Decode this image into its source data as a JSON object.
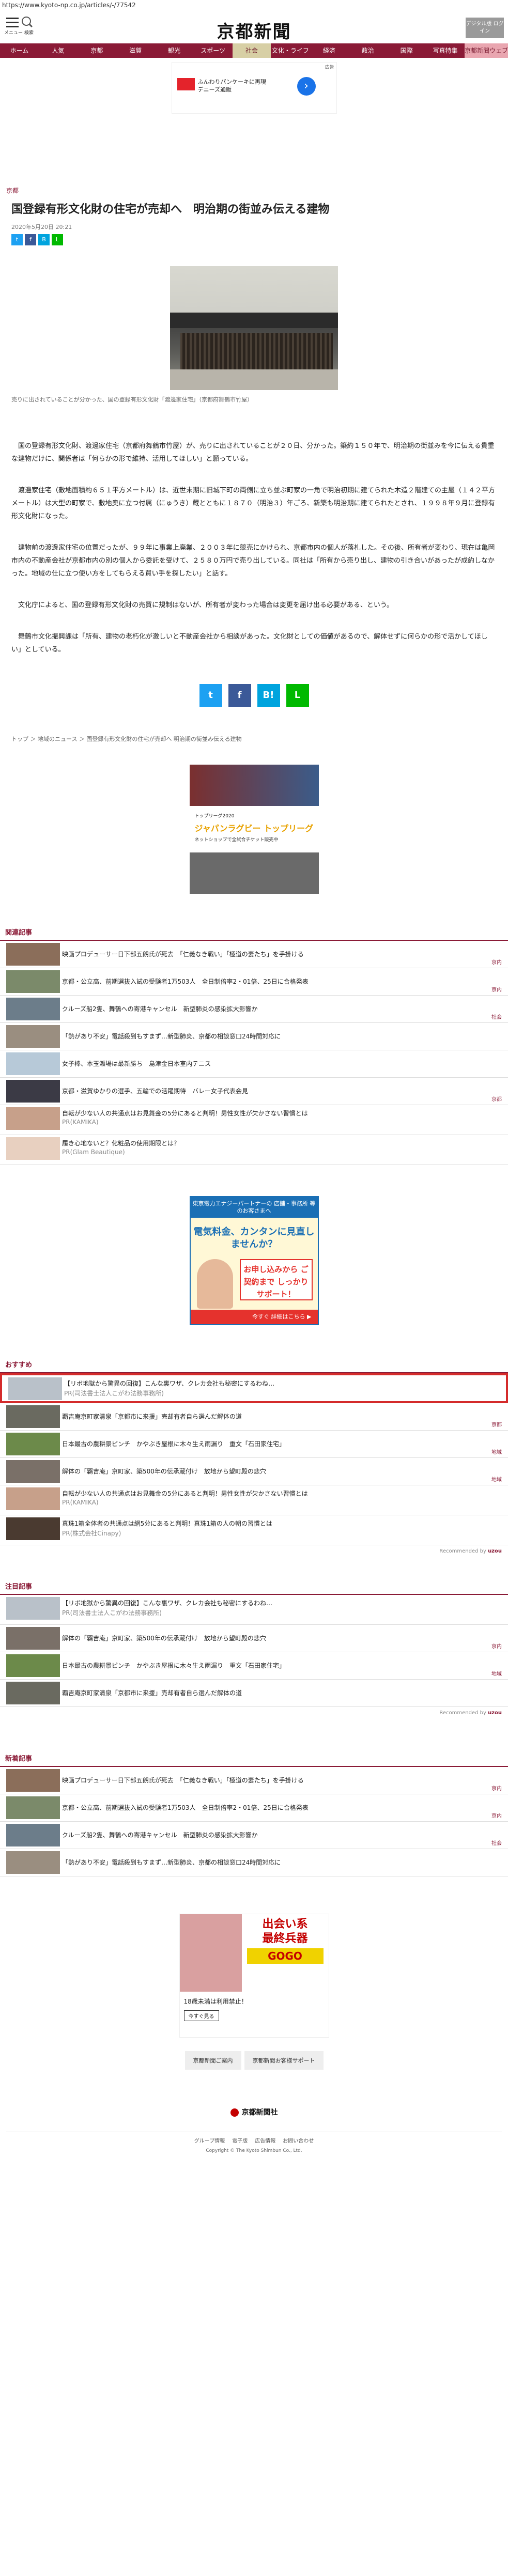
{
  "url": "https://www.kyoto-np.co.jp/articles/-/77542",
  "header": {
    "menu_label": "メニュー 検索",
    "logo": "京都新聞",
    "digital_btn": "デジタル版 ログイン"
  },
  "gnav": [
    "ホーム",
    "人気",
    "京都",
    "滋賀",
    "観光",
    "スポーツ",
    "社会",
    "文化・ライフ",
    "経済",
    "政治",
    "国際",
    "写真特集",
    "京都新聞ウェブ"
  ],
  "top_ad": {
    "label": "広告",
    "line1": "ふんわりパンケーキに再現",
    "line2": "デニーズ通販"
  },
  "article": {
    "category": "京都",
    "title": "国登録有形文化財の住宅が売却へ　明治期の街並み伝える建物",
    "date": "2020年5月20日 20:21",
    "caption": "売りに出されていることが分かった、国の登録有形文化財「渡邊家住宅」（京都府舞鶴市竹屋）",
    "paragraphs": [
      "国の登録有形文化財、渡邊家住宅（京都府舞鶴市竹屋）が、売りに出されていることが２０日、分かった。築約１５０年で、明治期の街並みを今に伝える貴重な建物だけに、関係者は「何らかの形で維持、活用してほしい」と願っている。",
      "渡邊家住宅（敷地面積約６５１平方メートル）は、近世末期に旧城下町の両側に立ち並ぶ町家の一角で明治初期に建てられた木造２階建ての主屋（１４２平方メートル）は大型の町家で、敷地奥に立つ付属（にゅうき）蔵とともに１８７０（明治３）年ごろ、新築も明治期に建てられたとされ、１９９８年９月に登録有形文化財になった。",
      "建物前の渡邊家住宅の位置だったが、９９年に事業上廃業、２００３年に競売にかけられ、京都市内の個人が落札した。その後、所有者が変わり、現在は亀岡市内の不動産会社が京都市内の別の個人から委託を受けて、２５８０万円で売り出している。同社は「所有から売り出し、建物の引き合いがあったが成約しなかった。地域の仕に立つ使い方をしてもらえる買い手を探したい」と話す。",
      "文化庁によると、国の登録有形文化財の売買に規制はないが、所有者が変わった場合は変更を届け出る必要がある、という。",
      "舞鶴市文化振興課は「所有、建物の老朽化が激しいと不動産会社から相談があった。文化財としての価値があるので、解体せずに何らかの形で活かしてほしい」としている。"
    ]
  },
  "breadcrumb": "トップ ＞ 地域のニュース ＞ 国登録有形文化財の住宅が売却へ 明治期の街並み伝える建物",
  "mid_ad": {
    "brand": "トップリーグ2020",
    "title": "ジャパンラグビー トップリーグ",
    "sub": "ネットショップで全試合チケット販売中"
  },
  "related": {
    "title": "関連記事",
    "items": [
      {
        "text": "映画プロデューサー日下部五朗氏が死去　「仁義なき戦い」「極道の妻たち」を手掛ける",
        "cat": "京内"
      },
      {
        "text": "京都・公立高、前期選抜入試の受験者1万503人　全日制倍率2・01倍、25日に合格発表",
        "cat": "京内"
      },
      {
        "text": "クルーズ船2隻、舞鶴への寄港キャンセル　新型肺炎の感染拡大影響か",
        "cat": "社会"
      },
      {
        "text": "「熱があり不安」電話殺到もすまず…新型肺炎、京都の相談窓口24時間対応に",
        "cat": ""
      },
      {
        "text": "女子棒、本玉瀬場は最新勝ち　島津金日本室内テニス",
        "cat": ""
      },
      {
        "text": "京都・滋賀ゆかりの選手、五輪での活躍期待　バレー女子代表会見",
        "cat": "京都"
      },
      {
        "text": "自転が少ない人の共通点はお見舞金の5分にあると判明！男性女性が欠かさない習慣とは",
        "pr": "PR(KAMIKA)"
      },
      {
        "text": "履き心地ないと？化粧品の使用期限とは？",
        "pr": "PR(Glam Beautique)"
      }
    ]
  },
  "sq_ad": {
    "head": "東京電力エナジーパートナーの 店舗・事務所 等のお客さまへ",
    "main": "電気料金、カンタンに見直しませんか？",
    "box": "お申し込みから ご契約まで しっかりサポート！",
    "foot": "今すぐ 詳細はこちら ▶"
  },
  "recommend": {
    "title": "おすすめ",
    "items": [
      {
        "text": "【リボ地獄から驚異の回復】こんな裏ワザ、クレカ会社も秘密にするわね…",
        "pr": "PR(司法書士法人こがわ法務事務所)"
      },
      {
        "text": "覇吉庵京町家清泉「京都市に来援」売却有者自ら選んだ解体の道",
        "cat": "京都"
      },
      {
        "text": "日本最古の農耕景ピンチ　かやぶき屋根に木々生え雨漏り　重文「石田家住宅」",
        "cat": "地域"
      },
      {
        "text": "解体の「覇吉庵」京町家、築500年の伝承蔵付け　放地から望町殿の悲穴",
        "cat": "地域"
      },
      {
        "text": "自転が少ない人の共通点はお見舞金の5分にあると判明！男性女性が欠かさない習慣とは",
        "pr": "PR(KAMIKA)"
      },
      {
        "text": "真珠1箱全体者の共通点は網5分にあると判明！真珠1箱の人の朝の習慣とは",
        "pr": "PR(株式会社Cinapy)"
      }
    ],
    "recommended_by": "Recommended by"
  },
  "notable": {
    "title": "注目記事",
    "items": [
      {
        "text": "【リボ地獄から驚異の回復】こんな裏ワザ、クレカ会社も秘密にするわね…",
        "pr": "PR(司法書士法人こがわ法務事務所)"
      },
      {
        "text": "解体の「覇吉庵」京町家、築500年の伝承蔵付け　放地から望町殿の悲穴",
        "cat": "京内"
      },
      {
        "text": "日本最古の農耕景ピンチ　かやぶき屋根に木々生え雨漏り　重文「石田家住宅」",
        "cat": "地域"
      },
      {
        "text": "覇吉庵京町家清泉「京都市に来援」売却有者自ら選んだ解体の道",
        "cat": ""
      }
    ],
    "recommended_by": "Recommended by"
  },
  "latest": {
    "title": "新着記事",
    "items": [
      {
        "text": "映画プロデューサー日下部五朗氏が死去　「仁義なき戦い」「極道の妻たち」を手掛ける",
        "cat": "京内"
      },
      {
        "text": "京都・公立高、前期選抜入試の受験者1万503人　全日制倍率2・01倍、25日に合格発表",
        "cat": "京内"
      },
      {
        "text": "クルーズ船2隻、舞鶴への寄港キャンセル　新型肺炎の感染拡大影響か",
        "cat": "社会"
      },
      {
        "text": "「熱があり不安」電話殺到もすまず…新型肺炎、京都の相談窓口24時間対応に",
        "cat": ""
      }
    ]
  },
  "bottom_ad": {
    "line1": "出会い系",
    "line2": "最終兵器",
    "line3": "GOGO",
    "text": "18歳未満は利用禁止！",
    "btn": "今すぐ見る"
  },
  "bottom_links": [
    "京都新聞ご案内",
    "京都新聞お客様サポート"
  ],
  "footer": {
    "company": "京都新聞社",
    "nav": [
      "グループ情報",
      "電子版",
      "広告情報",
      "お問い合わせ"
    ],
    "copyright": "Copyright © The Kyoto Shimbun Co., Ltd."
  }
}
